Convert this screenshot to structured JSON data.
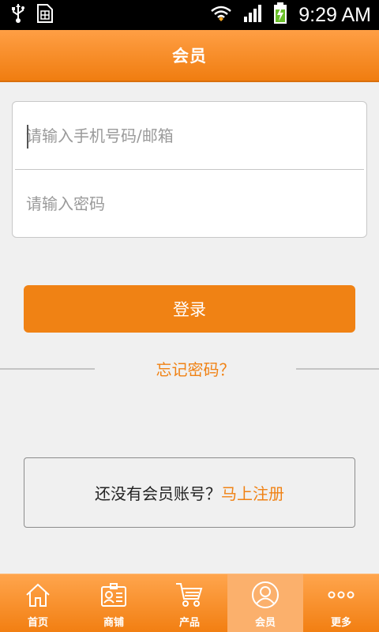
{
  "status_bar": {
    "time": "9:29 AM",
    "icons": [
      "usb-icon",
      "sim-icon",
      "wifi-icon",
      "signal-icon",
      "battery-charging-icon"
    ]
  },
  "header": {
    "title": "会员"
  },
  "form": {
    "account_placeholder": "请输入手机号码/邮箱",
    "account_value": "",
    "password_placeholder": "请输入密码",
    "password_value": ""
  },
  "actions": {
    "login_label": "登录",
    "forgot_label": "忘记密码？"
  },
  "register": {
    "prompt": "还没有会员账号？",
    "link": "马上注册"
  },
  "tab_bar": {
    "active_index": 3,
    "items": [
      {
        "label": "首页",
        "icon": "home-icon"
      },
      {
        "label": "商铺",
        "icon": "store-card-icon"
      },
      {
        "label": "产品",
        "icon": "cart-icon"
      },
      {
        "label": "会员",
        "icon": "user-icon"
      },
      {
        "label": "更多",
        "icon": "more-icon"
      }
    ]
  },
  "colors": {
    "accent": "#f08214",
    "status_bar": "#000000",
    "background": "#f0f0f0"
  }
}
